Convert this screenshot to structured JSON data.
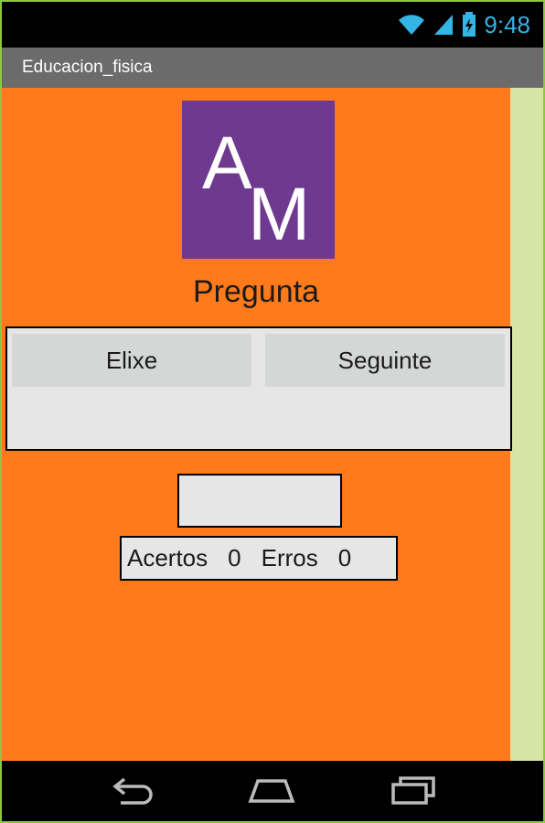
{
  "status_bar": {
    "time": "9:48",
    "icons": [
      "wifi-icon",
      "signal-icon",
      "battery-charging-icon"
    ]
  },
  "app": {
    "title": "Educacion_fisica"
  },
  "logo": {
    "text": "AM",
    "background": "#6e3a90"
  },
  "question": {
    "label": "Pregunta"
  },
  "buttons": {
    "choose": "Elixe",
    "next": "Seguinte"
  },
  "answer": {
    "value": ""
  },
  "score": {
    "hits_label": "Acertos",
    "hits_value": "0",
    "errors_label": "Erros",
    "errors_value": "0"
  },
  "navigation": {
    "icons": [
      "back-icon",
      "home-icon",
      "recent-apps-icon"
    ]
  },
  "colors": {
    "background": "#ff7a1a",
    "status_accent": "#33b5e5",
    "title_bar": "#6b6b6b",
    "right_strip": "#d6e4a6"
  }
}
